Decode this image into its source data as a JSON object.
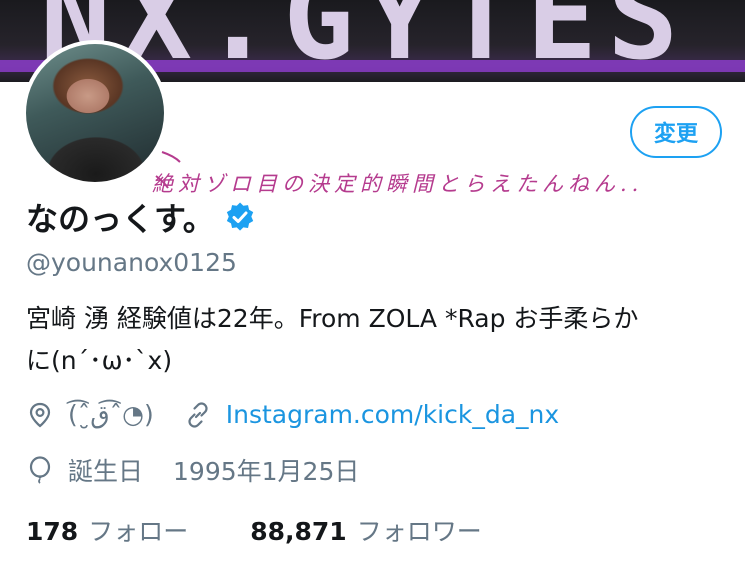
{
  "banner": {
    "text": "NX.GYTES"
  },
  "profile": {
    "edit_button_label": "変更",
    "annotation": "絶対ゾロ目の決定的瞬間とらえたんねん..",
    "display_name": "なのっくす。",
    "handle": "@younanox0125",
    "bio_line1": "宮崎 湧 経験値は22年。From ZOLA *Rap お手柔らか",
    "bio_line2": "に(n´･ω･`x)",
    "location": "(ˆ͡ق̮ˆ͡◔)",
    "website": "Instagram.com/kick_da_nx",
    "birthday_label": "誕生日",
    "birthday_value": "1995年1月25日",
    "following_count": "178",
    "following_label": "フォロー",
    "followers_count": "88,871",
    "followers_label": "フォロワー"
  },
  "icons": {
    "location": "location-pin-icon",
    "link": "link-icon",
    "birthday": "balloon-icon",
    "verified": "verified-badge-icon"
  },
  "colors": {
    "accent": "#1da1f2",
    "link": "#1b95e0",
    "secondary_text": "#657786",
    "annotation": "#b53b8e",
    "banner_glow": "#8a3cc8"
  }
}
